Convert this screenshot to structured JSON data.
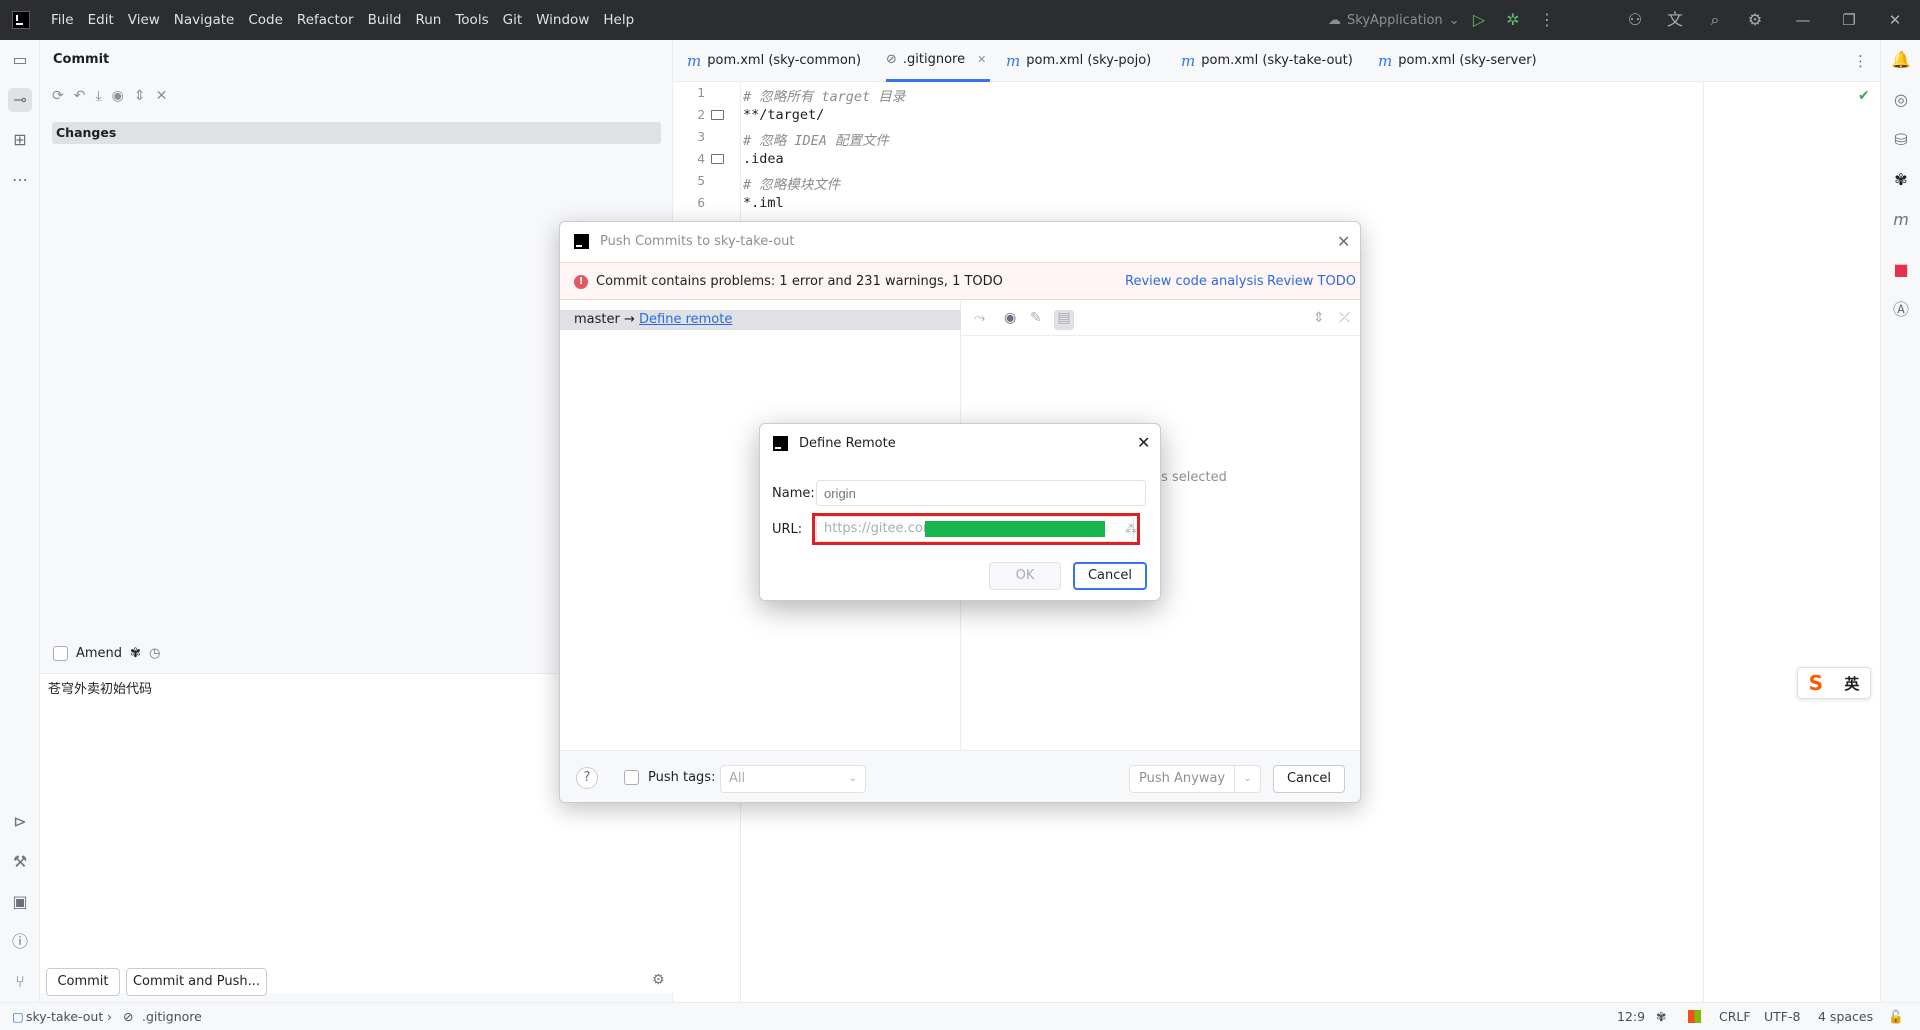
{
  "menu": [
    "File",
    "Edit",
    "View",
    "Navigate",
    "Code",
    "Refactor",
    "Build",
    "Run",
    "Tools",
    "Git",
    "Window",
    "Help"
  ],
  "titlebar": {
    "run_config": "SkyApplication"
  },
  "commit_panel": {
    "title": "Commit",
    "changes_label": "Changes",
    "amend_label": "Amend",
    "message": "苍穹外卖初始代码",
    "commit_button": "Commit",
    "commit_push_button": "Commit and Push..."
  },
  "tabs": [
    {
      "label": "pom.xml (sky-common)",
      "active": false
    },
    {
      "label": ".gitignore",
      "active": true
    },
    {
      "label": "pom.xml (sky-pojo)",
      "active": false
    },
    {
      "label": "pom.xml (sky-take-out)",
      "active": false
    },
    {
      "label": "pom.xml (sky-server)",
      "active": false
    }
  ],
  "editor": {
    "lines": [
      {
        "n": "1",
        "text": "# 忽略所有 target 目录",
        "comment": true,
        "folder": false
      },
      {
        "n": "2",
        "text": "**/target/",
        "comment": false,
        "folder": true
      },
      {
        "n": "3",
        "text": "# 忽略 IDEA 配置文件",
        "comment": true,
        "folder": false
      },
      {
        "n": "4",
        "text": ".idea",
        "comment": false,
        "folder": true
      },
      {
        "n": "5",
        "text": "# 忽略模块文件",
        "comment": true,
        "folder": false
      },
      {
        "n": "6",
        "text": "*.iml",
        "comment": false,
        "folder": false
      }
    ]
  },
  "push_dialog": {
    "title": "Push Commits to sky-take-out",
    "problem_text": "Commit contains problems: 1 error and 231 warnings, 1 TODO",
    "review_analysis": "Review code analysis",
    "review_todo": "Review TODO",
    "branch": "master →",
    "define_remote": "Define remote",
    "commits_selected": "ts selected",
    "push_tags_label": "Push tags:",
    "tags_value": "All",
    "push_anyway": "Push Anyway",
    "cancel": "Cancel"
  },
  "define_remote_dialog": {
    "title": "Define Remote",
    "name_label": "Name:",
    "name_placeholder": "origin",
    "url_label": "URL:",
    "url_value": "https://gitee.com",
    "ok": "OK",
    "cancel": "Cancel"
  },
  "statusbar": {
    "project": "sky-take-out",
    "file": ".gitignore",
    "position": "12:9",
    "line_ending": "CRLF",
    "encoding": "UTF-8",
    "indent": "4 spaces"
  },
  "ime": {
    "lang": "英"
  },
  "colors": {
    "accent": "#3574f0",
    "error": "#e55765",
    "highlight_outline": "#e02020",
    "redaction": "#16b64b"
  }
}
